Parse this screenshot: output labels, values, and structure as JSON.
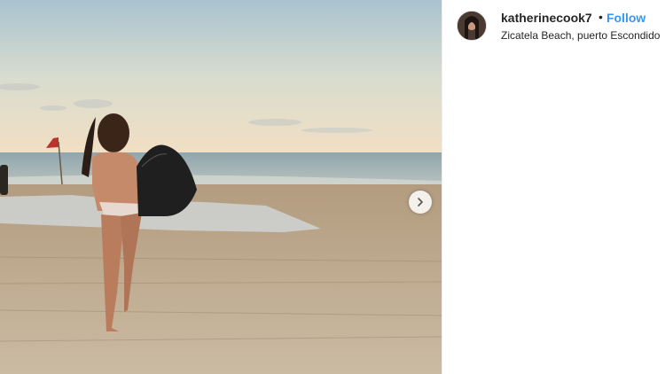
{
  "post": {
    "username": "katherinecook7",
    "separator": "•",
    "follow_label": "Follow",
    "location": "Zicatela Beach, puerto Escondido"
  },
  "media": {
    "description": "Photo of a woman walking on a sandy beach at sunset carrying a black surfboard toward the ocean",
    "next_icon": "chevron-right-icon"
  },
  "colors": {
    "follow_blue": "#3897f0",
    "text_dark": "#262626",
    "border": "#efefef"
  }
}
